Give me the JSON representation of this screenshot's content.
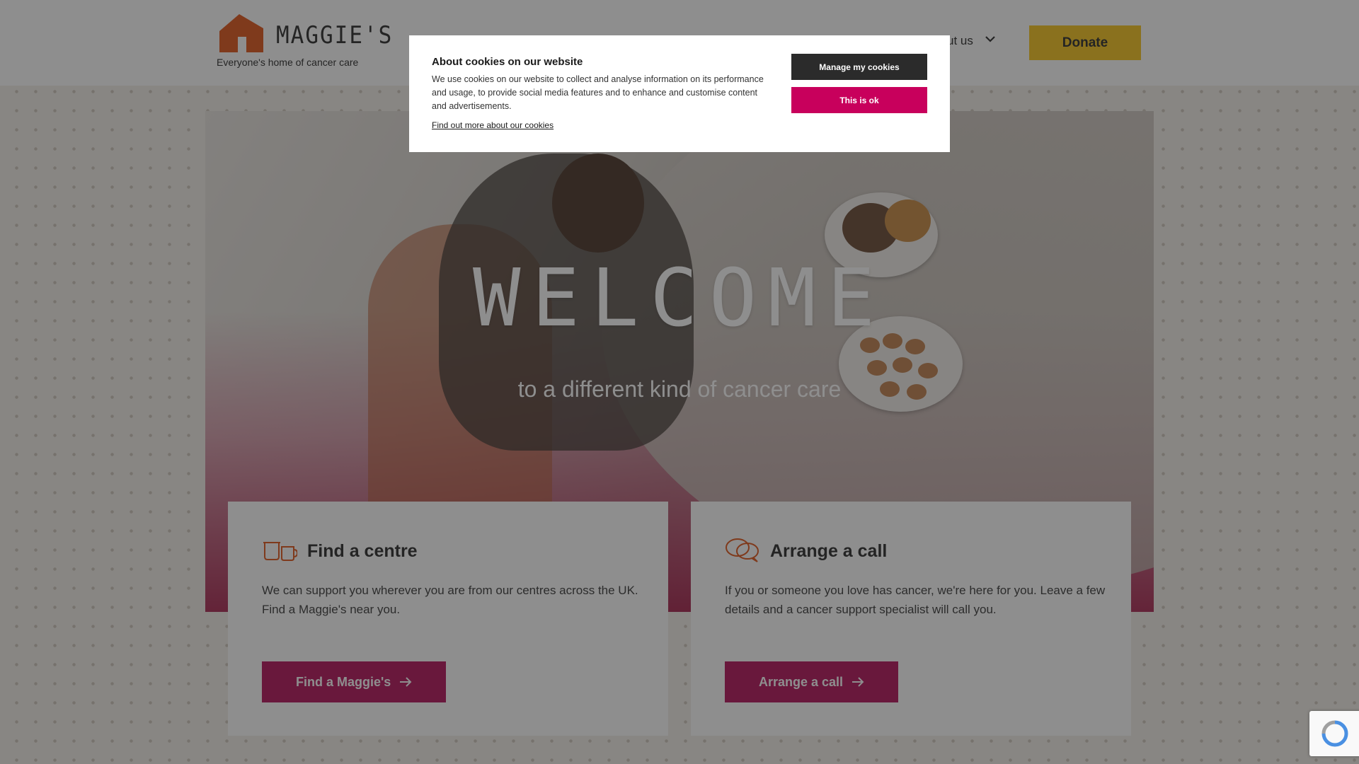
{
  "header": {
    "logo_word": "MAGGIE'S",
    "logo_tagline": "Everyone's home of cancer care",
    "nav_about": "ut us",
    "donate_label": "Donate"
  },
  "hero": {
    "title": "WELCOME",
    "subtitle": "to a different kind of cancer care"
  },
  "cards": [
    {
      "title": "Find a centre",
      "text": "We can support you wherever you are from our centres across the UK. Find a Maggie's near you.",
      "button": "Find a Maggie's",
      "icon": "mugs-icon"
    },
    {
      "title": "Arrange a call",
      "text": "If you or someone you love has cancer, we're here for you. Leave a few details and a cancer support specialist will call you.",
      "button": "Arrange a call",
      "icon": "speech-bubbles-icon"
    }
  ],
  "cookie_dialog": {
    "title": "About cookies on our website",
    "text": "We use cookies on our website to collect and analyse information on its performance and usage, to provide social media features and to enhance and customise content and advertisements.",
    "link": "Find out more about our cookies",
    "manage_button": "Manage my cookies",
    "ok_button": "This is ok"
  },
  "colors": {
    "brand_orange": "#e0561b",
    "donate_yellow": "#f7c51e",
    "button_magenta": "#b5125b",
    "cookie_ok": "#c8005c"
  }
}
